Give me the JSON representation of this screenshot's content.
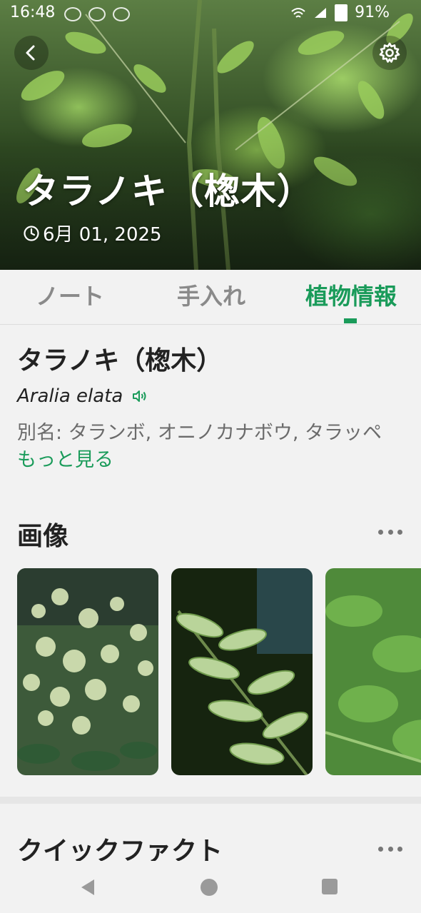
{
  "status_bar": {
    "time": "16:48",
    "battery": "91%"
  },
  "header": {
    "title": "タラノキ（楤木）",
    "date": "6月 01, 2025"
  },
  "tabs": [
    {
      "label": "ノート",
      "active": false
    },
    {
      "label": "手入れ",
      "active": false
    },
    {
      "label": "植物情報",
      "active": true
    }
  ],
  "plant": {
    "name": "タラノキ（楤木）",
    "scientific_name": "Aralia elata",
    "aliases_text": "別名: タランボ, オニノカナボウ, タラッペ",
    "more_label": "もっと見る"
  },
  "images_section": {
    "title": "画像"
  },
  "quick_facts": {
    "title": "クイックファクト"
  },
  "colors": {
    "accent": "#1a9b5a"
  },
  "icons": {
    "back": "back-arrow-icon",
    "settings": "gear-icon",
    "date": "clock-icon",
    "audio": "speaker-icon",
    "more": "more-horizontal-icon"
  }
}
